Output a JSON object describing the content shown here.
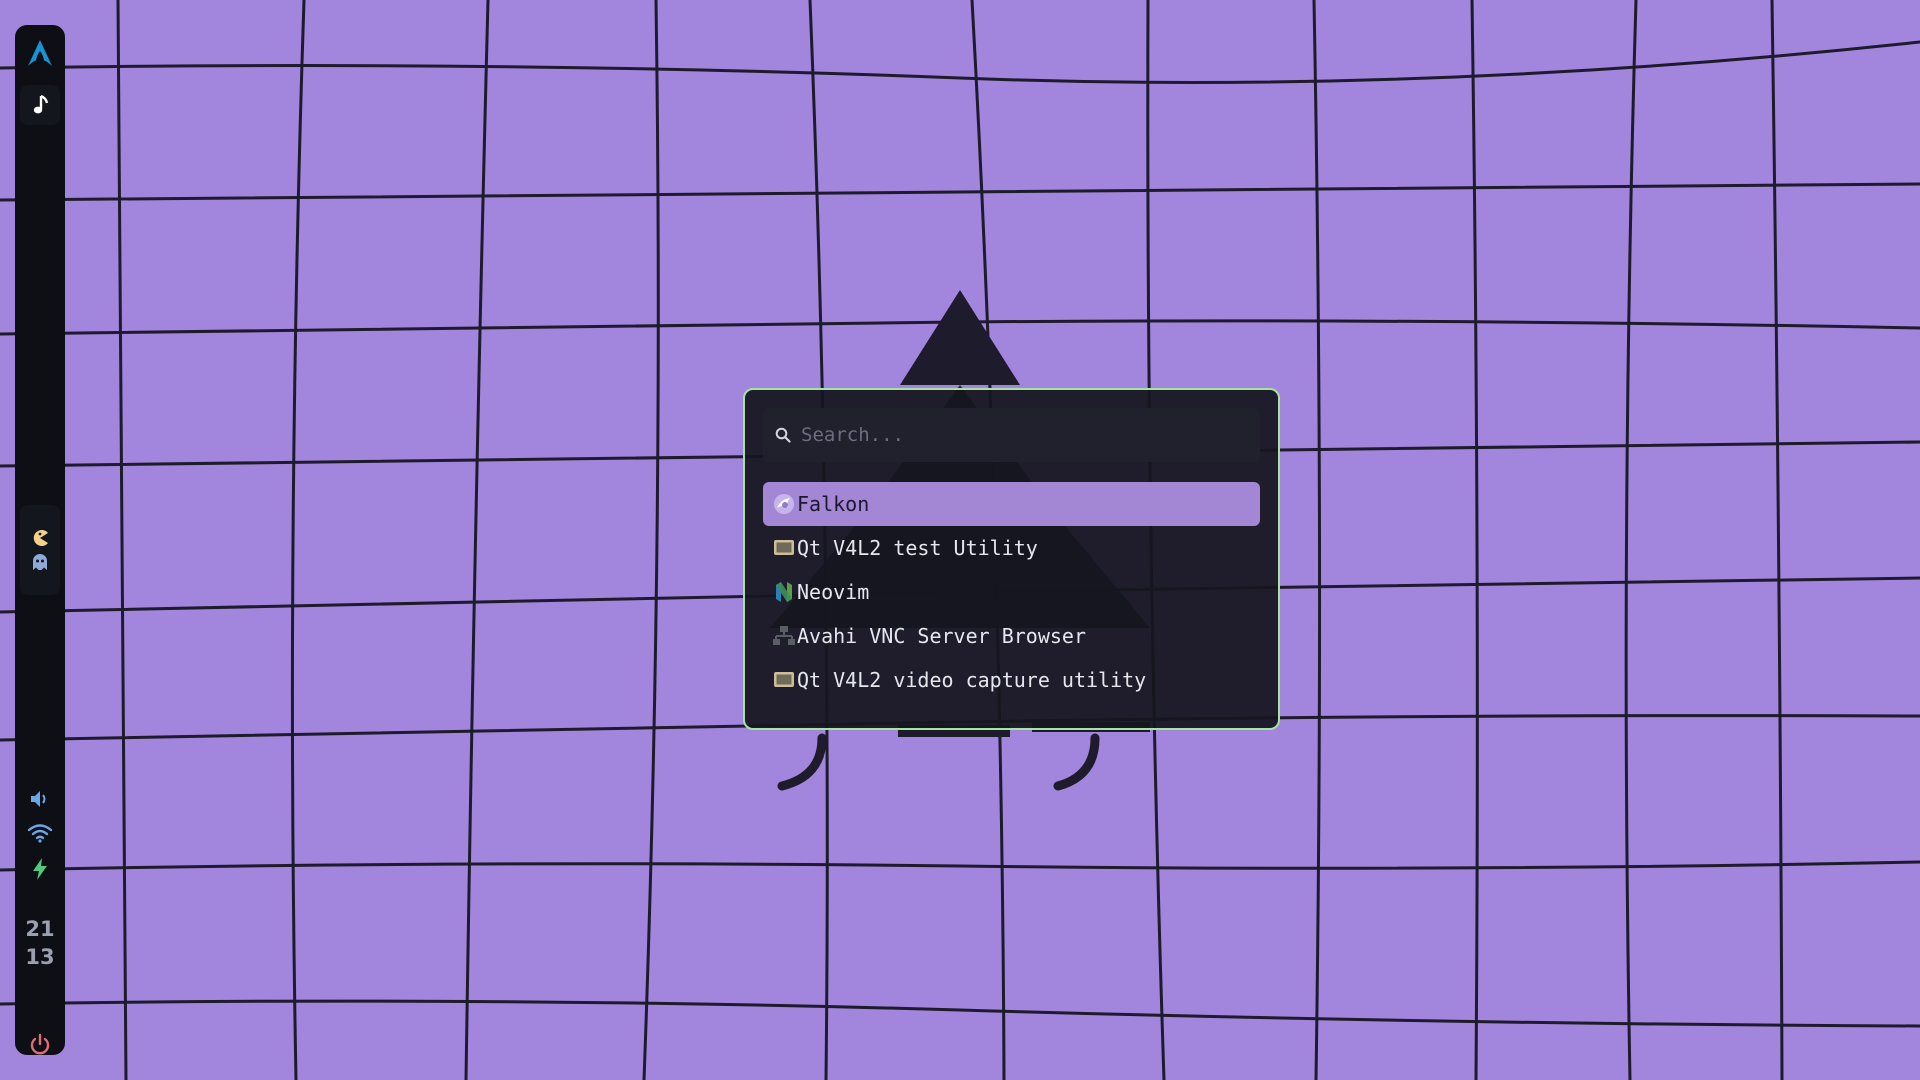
{
  "bar": {
    "logo_icon": "arch-linux-icon",
    "music_icon": "music-note-icon",
    "pacman_icon": "pacman-icon",
    "ghost_icon": "ghost-icon",
    "volume_icon": "volume-icon",
    "wifi_icon": "wifi-icon",
    "battery_icon": "charging-bolt-icon",
    "clock_hour": "21",
    "clock_minute": "13",
    "power_icon": "power-icon"
  },
  "launcher": {
    "search_placeholder": "Search...",
    "search_value": "",
    "items": [
      {
        "label": "Falkon",
        "icon": "falkon-icon",
        "selected": true
      },
      {
        "label": "Qt V4L2 test Utility",
        "icon": "qt-v4l2-icon",
        "selected": false
      },
      {
        "label": "Neovim",
        "icon": "neovim-icon",
        "selected": false
      },
      {
        "label": "Avahi VNC Server Browser",
        "icon": "network-icon",
        "selected": false
      },
      {
        "label": "Qt V4L2 video capture utility",
        "icon": "qt-v4l2-icon",
        "selected": false
      }
    ]
  },
  "colors": {
    "wallpaper": "#a285dc",
    "grid_lines": "#1e1b2c",
    "bar_bg": "#0d0f15",
    "launcher_border": "#a6e3a1",
    "selected_bg": "#a487d4",
    "arch_blue": "#1793d1",
    "power_red": "#e06c75",
    "bolt_green": "#4ec97d"
  }
}
